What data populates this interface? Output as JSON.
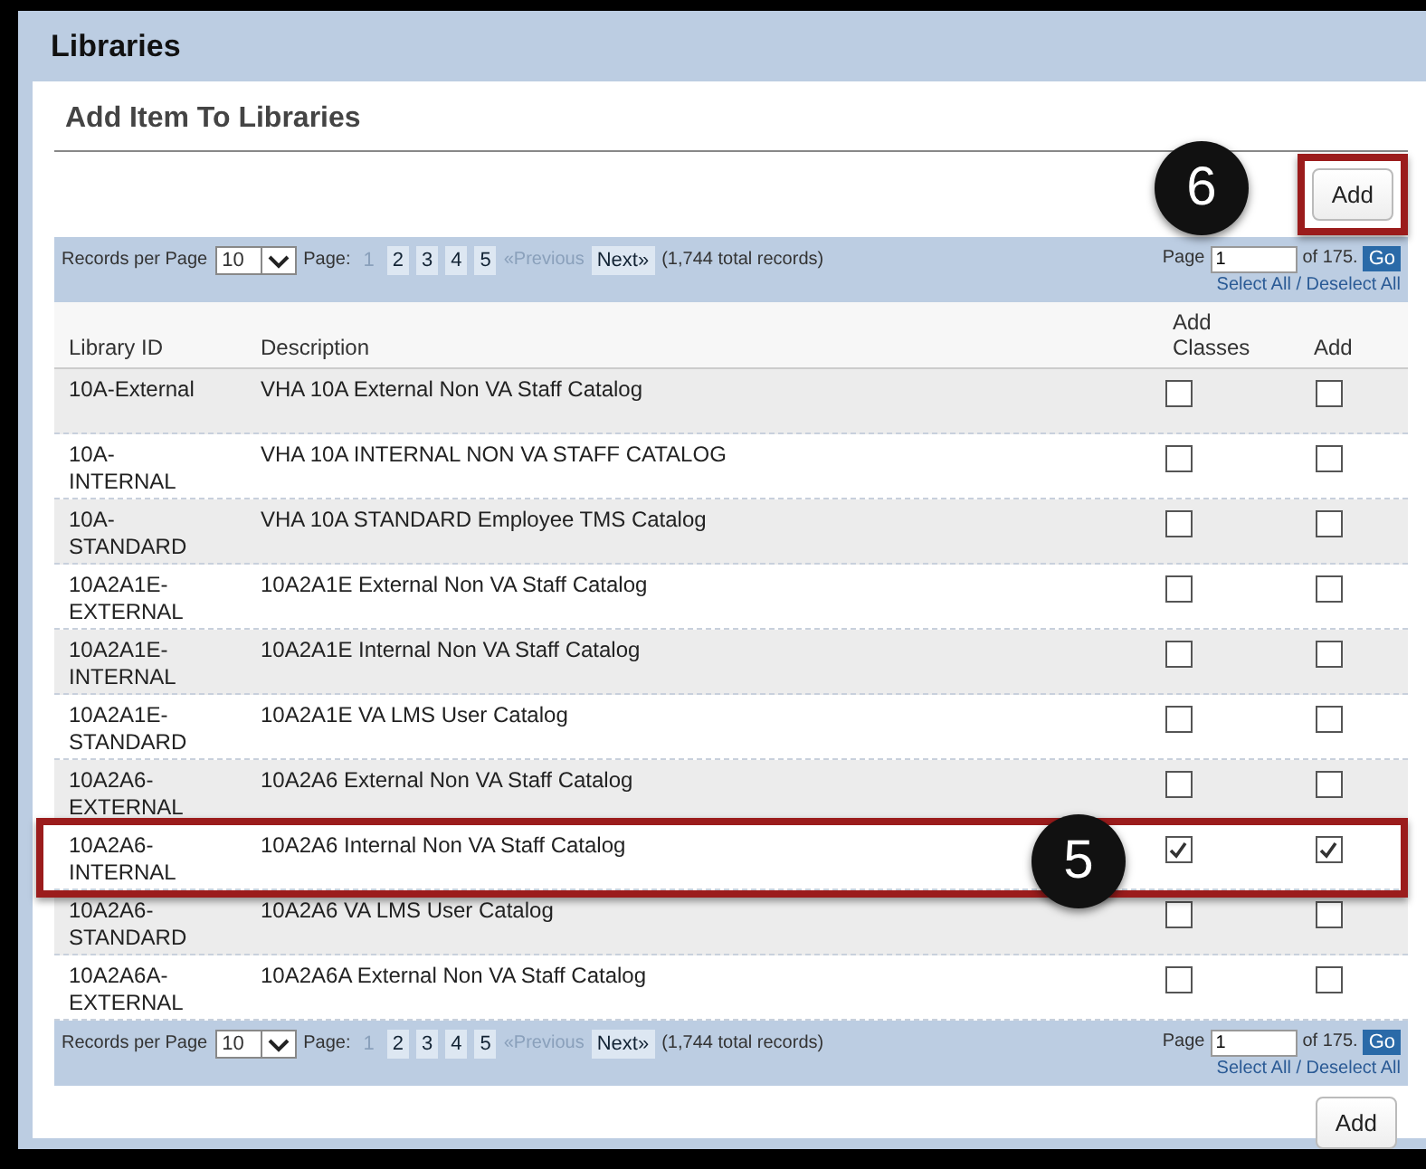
{
  "header": {
    "title": "Libraries"
  },
  "panel": {
    "title": "Add Item To Libraries"
  },
  "top_add": {
    "label": "Add",
    "highlighted": true,
    "callout": "6"
  },
  "pager_top": {
    "records_label": "Records per Page",
    "per_page": "10",
    "page_label": "Page:",
    "pages": [
      {
        "label": "1",
        "selected": true
      },
      {
        "label": "2",
        "selected": false
      },
      {
        "label": "3",
        "selected": false
      },
      {
        "label": "4",
        "selected": false
      },
      {
        "label": "5",
        "selected": false
      }
    ],
    "previous": "«Previous",
    "next": "Next»",
    "total": "(1,744 total records)",
    "goto_label": "Page",
    "goto_value": "1",
    "of_label": "of 175.",
    "go": "Go",
    "select_all": "Select All / Deselect All"
  },
  "table": {
    "columns": [
      "Library ID",
      "Description",
      "Add Classes",
      "Add"
    ],
    "rows": [
      {
        "id": "10A-External",
        "description": "VHA 10A External Non VA Staff Catalog",
        "add_classes": false,
        "add": false,
        "highlighted": false
      },
      {
        "id": "10A-INTERNAL",
        "description": "VHA 10A INTERNAL NON VA STAFF CATALOG",
        "add_classes": false,
        "add": false,
        "highlighted": false
      },
      {
        "id": "10A-STANDARD",
        "description": "VHA 10A STANDARD Employee TMS Catalog",
        "add_classes": false,
        "add": false,
        "highlighted": false
      },
      {
        "id": "10A2A1E-EXTERNAL",
        "description": "10A2A1E External Non VA Staff Catalog",
        "add_classes": false,
        "add": false,
        "highlighted": false
      },
      {
        "id": "10A2A1E-INTERNAL",
        "description": "10A2A1E Internal Non VA Staff Catalog",
        "add_classes": false,
        "add": false,
        "highlighted": false
      },
      {
        "id": "10A2A1E-STANDARD",
        "description": "10A2A1E VA LMS User Catalog",
        "add_classes": false,
        "add": false,
        "highlighted": false
      },
      {
        "id": "10A2A6-EXTERNAL",
        "description": "10A2A6 External Non VA Staff Catalog",
        "add_classes": false,
        "add": false,
        "highlighted": false
      },
      {
        "id": "10A2A6-INTERNAL",
        "description": "10A2A6 Internal Non VA Staff Catalog",
        "add_classes": true,
        "add": true,
        "highlighted": true,
        "callout": "5"
      },
      {
        "id": "10A2A6-STANDARD",
        "description": "10A2A6 VA LMS User Catalog",
        "add_classes": false,
        "add": false,
        "highlighted": false
      },
      {
        "id": "10A2A6A-EXTERNAL",
        "description": "10A2A6A External Non VA Staff Catalog",
        "add_classes": false,
        "add": false,
        "highlighted": false
      }
    ]
  },
  "pager_bottom": {
    "records_label": "Records per Page",
    "per_page": "10",
    "page_label": "Page:",
    "pages": [
      {
        "label": "1",
        "selected": true
      },
      {
        "label": "2",
        "selected": false
      },
      {
        "label": "3",
        "selected": false
      },
      {
        "label": "4",
        "selected": false
      },
      {
        "label": "5",
        "selected": false
      }
    ],
    "previous": "«Previous",
    "next": "Next»",
    "total": "(1,744 total records)",
    "goto_label": "Page",
    "goto_value": "1",
    "of_label": "of 175.",
    "go": "Go",
    "select_all": "Select All / Deselect All"
  },
  "bottom_add": {
    "label": "Add"
  }
}
